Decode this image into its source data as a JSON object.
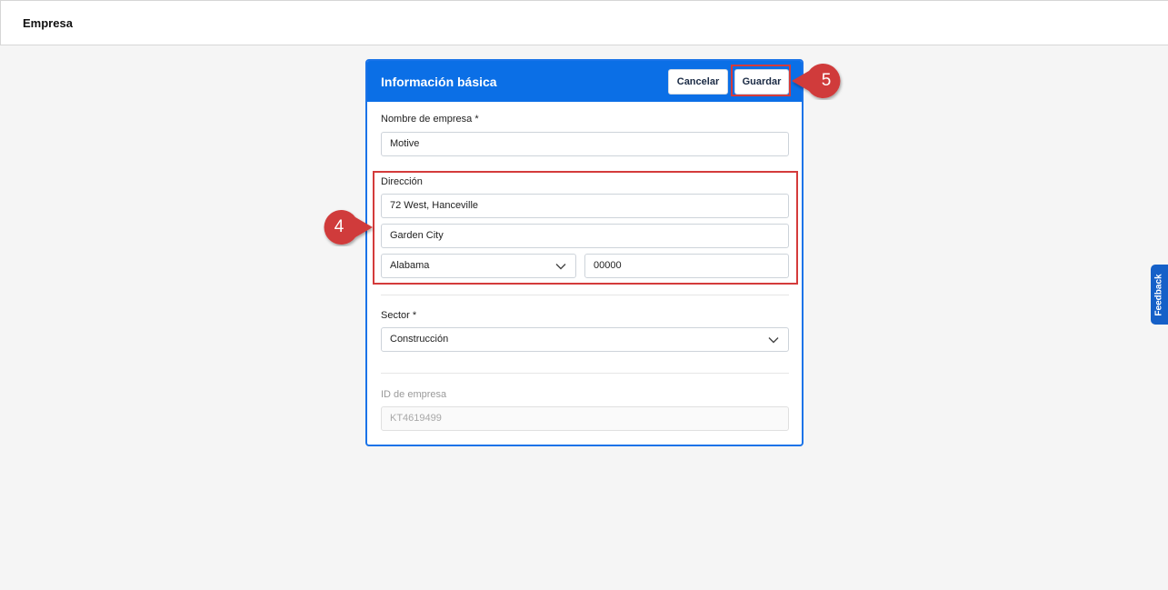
{
  "page": {
    "title": "Empresa"
  },
  "card": {
    "title": "Información básica",
    "cancel_label": "Cancelar",
    "save_label": "Guardar"
  },
  "company_name": {
    "label": "Nombre de empresa *",
    "value": "Motive"
  },
  "address": {
    "label": "Dirección",
    "line1": "72 West, Hanceville",
    "line2": "Garden City",
    "state": "Alabama",
    "zip": "00000"
  },
  "sector": {
    "label": "Sector *",
    "value": "Construcción"
  },
  "company_id": {
    "label": "ID de empresa",
    "value": "KT4619499"
  },
  "annotations": {
    "step4": "4",
    "step5": "5",
    "highlight_color": "#d43b3b",
    "marker_color": "#d03a3a"
  },
  "feedback": {
    "label": "Feedback"
  },
  "colors": {
    "header_blue": "#0b6fe6",
    "feedback_blue": "#1560c8"
  }
}
